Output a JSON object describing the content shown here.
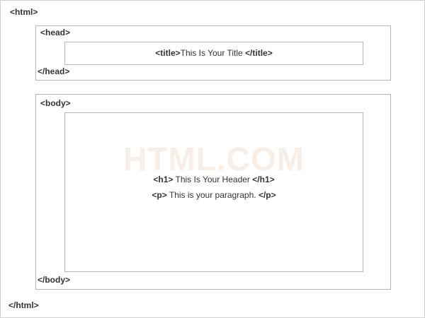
{
  "html_open": "<html>",
  "html_close": "</html>",
  "head": {
    "open": "<head>",
    "close": "</head>",
    "title_open": "<title>",
    "title_text": "This Is Your Title",
    "title_close": "</title>"
  },
  "body": {
    "open": "<body>",
    "close": "</body>",
    "h1_open": "<h1>",
    "h1_text": "This Is Your Header",
    "h1_close": "</h1>",
    "p_open": "<p>",
    "p_text": "This is your paragraph.",
    "p_close": "</p>"
  },
  "watermark": "HTML.COM",
  "colors": {
    "border": "#b5b5b5",
    "text": "#333333",
    "watermark": "#f7eee8"
  }
}
